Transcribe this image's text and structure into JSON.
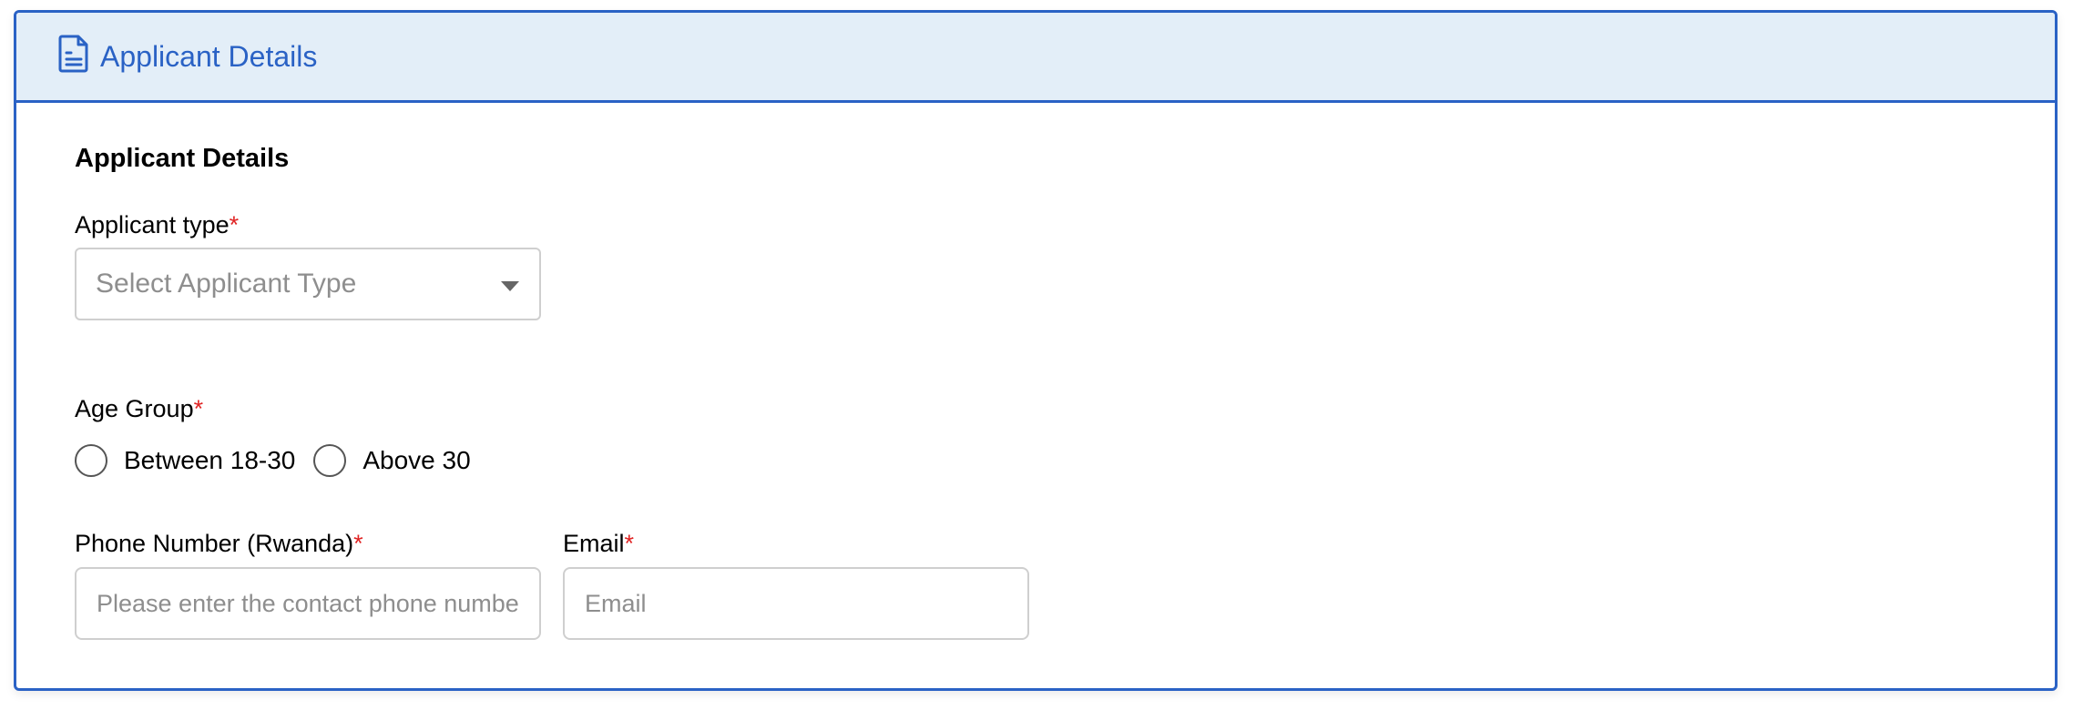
{
  "header": {
    "icon": "document-icon",
    "title": "Applicant Details"
  },
  "section": {
    "title": "Applicant Details"
  },
  "applicant_type": {
    "label": "Applicant type",
    "required_mark": "*",
    "placeholder": "Select Applicant Type"
  },
  "age_group": {
    "label": "Age Group",
    "required_mark": "*",
    "options": [
      {
        "label": "Between 18-30",
        "selected": false
      },
      {
        "label": "Above 30",
        "selected": false
      }
    ]
  },
  "phone": {
    "label": "Phone Number (Rwanda)",
    "required_mark": "*",
    "placeholder": "Please enter the contact phone number"
  },
  "email": {
    "label": "Email",
    "required_mark": "*",
    "placeholder": "Email"
  },
  "colors": {
    "accent": "#2a62c5",
    "header_bg": "#e3eef8",
    "required": "#e02424"
  }
}
